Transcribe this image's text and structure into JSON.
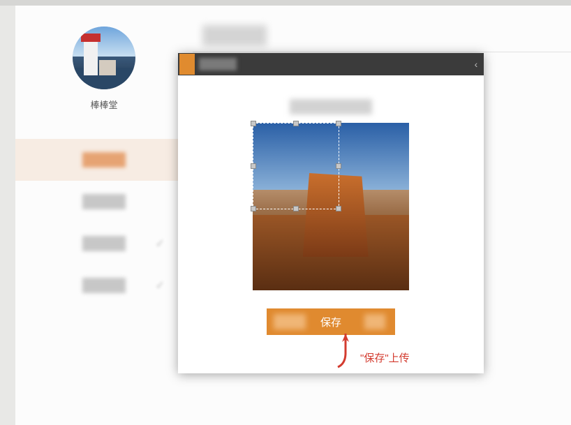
{
  "sidebar": {
    "username": "棒棒堂"
  },
  "modal": {
    "save_label": "保存"
  },
  "annotation": {
    "text": "\"保存\"上传"
  }
}
